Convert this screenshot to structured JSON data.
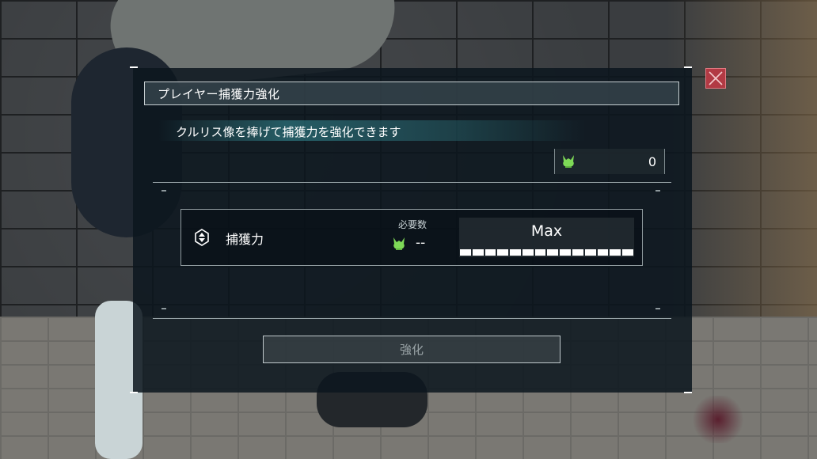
{
  "dialog": {
    "title": "プレイヤー捕獲力強化",
    "description": "クルリス像を捧げて捕獲力を強化できます",
    "close_icon": "close-x-icon",
    "currency": {
      "icon": "lifmunk-effigy-icon",
      "amount": "0"
    }
  },
  "stat": {
    "icon": "capture-power-icon",
    "label": "捕獲力",
    "required_label": "必要数",
    "required_icon": "lifmunk-effigy-icon",
    "required_value": "--",
    "level_text": "Max",
    "level_progress": 1.0,
    "level_segments": 14
  },
  "action": {
    "upgrade_label": "強化",
    "enabled": false
  },
  "colors": {
    "accent_teal": "#3ca8b4",
    "close_red": "#b23a44",
    "effigy_green": "#7ed957"
  }
}
